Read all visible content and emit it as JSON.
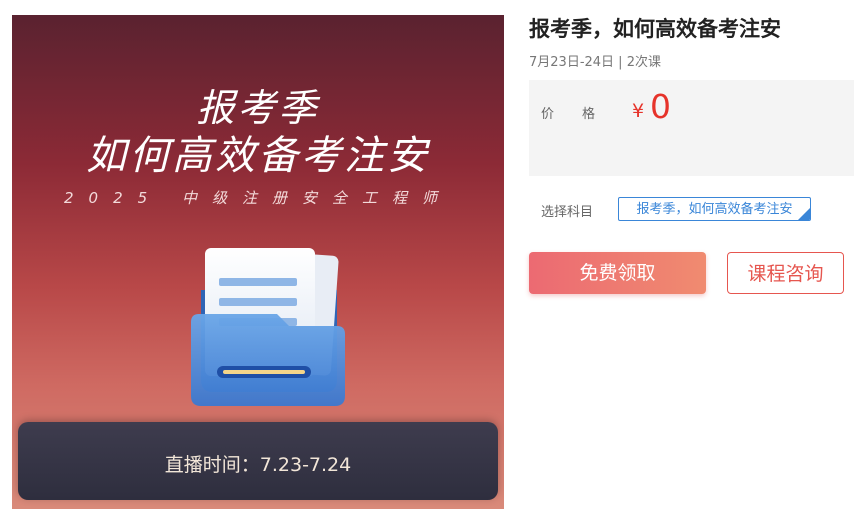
{
  "banner": {
    "title_line1": "报考季",
    "title_line2": "如何高效备考注安",
    "subtitle": "2025  中级注册安全工程师",
    "live_time": "直播时间：7.23-7.24"
  },
  "course": {
    "title": "报考季，如何高效备考注安",
    "meta": "7月23日-24日 | 2次课",
    "price_label_1": "价",
    "price_label_2": "格",
    "currency": "¥",
    "price": "0",
    "subject_label": "选择科目",
    "subject_selected": "报考季，如何高效备考注安"
  },
  "actions": {
    "free_label": "免费领取",
    "consult_label": "课程咨询"
  },
  "colors": {
    "accent_red": "#e6332a",
    "selected_blue": "#3a86d8"
  },
  "icons": {
    "folder": "folder-document-icon",
    "check": "check-icon"
  }
}
